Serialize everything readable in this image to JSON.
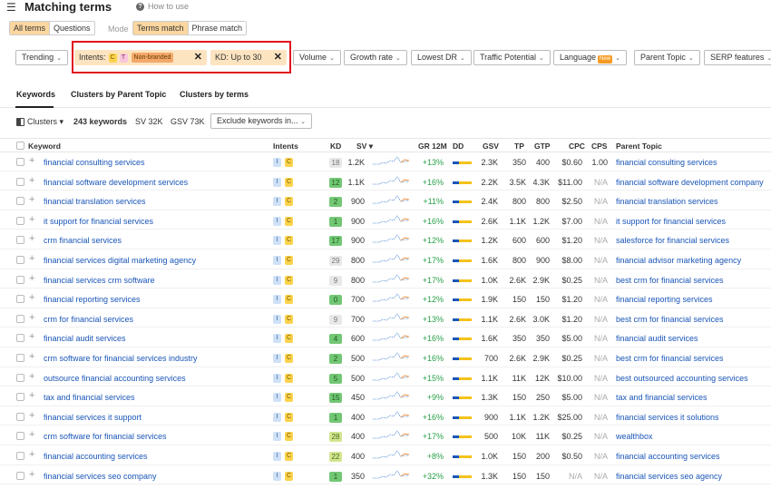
{
  "header": {
    "menu_icon": "hamburger-icon",
    "title": "Matching terms",
    "help_label": "How to use"
  },
  "tabs_primary": [
    {
      "label": "All terms",
      "active": true
    },
    {
      "label": "Questions",
      "active": false
    }
  ],
  "mode": {
    "label": "Mode",
    "options": [
      {
        "label": "Terms match",
        "active": true
      },
      {
        "label": "Phrase match",
        "active": false
      }
    ]
  },
  "filters": {
    "trending": "Trending",
    "intents_label": "Intents:",
    "intent_c": "C",
    "intent_t": "T",
    "non_branded": "Non-branded",
    "kd_label": "KD: Up to 30",
    "close": "✕",
    "volume": "Volume",
    "growth": "Growth rate",
    "lowest_dr": "Lowest DR",
    "traffic_potential": "Traffic Potential",
    "language": "Language",
    "new_badge": "New",
    "parent_topic": "Parent Topic",
    "serp": "SERP features"
  },
  "view_tabs": [
    {
      "label": "Keywords",
      "active": true
    },
    {
      "label": "Clusters by Parent Topic",
      "active": false
    },
    {
      "label": "Clusters by terms",
      "active": false
    }
  ],
  "summary": {
    "clusters": "Clusters",
    "keywords": "243 keywords",
    "sv": "SV 32K",
    "gsv": "GSV 73K",
    "exclude": "Exclude keywords in..."
  },
  "columns": {
    "keyword": "Keyword",
    "intents": "Intents",
    "kd": "KD",
    "sv": "SV",
    "gr": "GR 12M",
    "dd": "DD",
    "gsv": "GSV",
    "tp": "TP",
    "gtp": "GTP",
    "cpc": "CPC",
    "cps": "CPS",
    "parent": "Parent Topic"
  },
  "rows": [
    {
      "kw": "financial consulting services",
      "kd": "18",
      "sv": "1.2K",
      "gr": "+13%",
      "gsv": "2.3K",
      "tp": "350",
      "gtp": "400",
      "cpc": "$0.60",
      "cps": "1.00",
      "parent": "financial consulting services"
    },
    {
      "kw": "financial software development services",
      "kd": "12",
      "sv": "1.1K",
      "gr": "+16%",
      "gsv": "2.2K",
      "tp": "3.5K",
      "gtp": "4.3K",
      "cpc": "$11.00",
      "cps": "N/A",
      "parent": "financial software development company"
    },
    {
      "kw": "financial translation services",
      "kd": "2",
      "sv": "900",
      "gr": "+11%",
      "gsv": "2.4K",
      "tp": "800",
      "gtp": "800",
      "cpc": "$2.50",
      "cps": "N/A",
      "parent": "financial translation services"
    },
    {
      "kw": "it support for financial services",
      "kd": "1",
      "sv": "900",
      "gr": "+16%",
      "gsv": "2.6K",
      "tp": "1.1K",
      "gtp": "1.2K",
      "cpc": "$7.00",
      "cps": "N/A",
      "parent": "it support for financial services"
    },
    {
      "kw": "crm financial services",
      "kd": "17",
      "sv": "900",
      "gr": "+12%",
      "gsv": "1.2K",
      "tp": "600",
      "gtp": "600",
      "cpc": "$1.20",
      "cps": "N/A",
      "parent": "salesforce for financial services"
    },
    {
      "kw": "financial services digital marketing agency",
      "kd": "29",
      "sv": "800",
      "gr": "+17%",
      "gsv": "1.6K",
      "tp": "800",
      "gtp": "900",
      "cpc": "$8.00",
      "cps": "N/A",
      "parent": "financial advisor marketing agency"
    },
    {
      "kw": "financial services crm software",
      "kd": "9",
      "sv": "800",
      "gr": "+17%",
      "gsv": "1.0K",
      "tp": "2.6K",
      "gtp": "2.9K",
      "cpc": "$0.25",
      "cps": "N/A",
      "parent": "best crm for financial services"
    },
    {
      "kw": "financial reporting services",
      "kd": "0",
      "sv": "700",
      "gr": "+12%",
      "gsv": "1.9K",
      "tp": "150",
      "gtp": "150",
      "cpc": "$1.20",
      "cps": "N/A",
      "parent": "financial reporting services"
    },
    {
      "kw": "crm for financial services",
      "kd": "9",
      "sv": "700",
      "gr": "+13%",
      "gsv": "1.1K",
      "tp": "2.6K",
      "gtp": "3.0K",
      "cpc": "$1.20",
      "cps": "N/A",
      "parent": "best crm for financial services"
    },
    {
      "kw": "financial audit services",
      "kd": "4",
      "sv": "600",
      "gr": "+16%",
      "gsv": "1.6K",
      "tp": "350",
      "gtp": "350",
      "cpc": "$5.00",
      "cps": "N/A",
      "parent": "financial audit services"
    },
    {
      "kw": "crm software for financial services industry",
      "kd": "2",
      "sv": "500",
      "gr": "+16%",
      "gsv": "700",
      "tp": "2.6K",
      "gtp": "2.9K",
      "cpc": "$0.25",
      "cps": "N/A",
      "parent": "best crm for financial services"
    },
    {
      "kw": "outsource financial accounting services",
      "kd": "5",
      "sv": "500",
      "gr": "+15%",
      "gsv": "1.1K",
      "tp": "11K",
      "gtp": "12K",
      "cpc": "$10.00",
      "cps": "N/A",
      "parent": "best outsourced accounting services"
    },
    {
      "kw": "tax and financial services",
      "kd": "15",
      "sv": "450",
      "gr": "+9%",
      "gsv": "1.3K",
      "tp": "150",
      "gtp": "250",
      "cpc": "$5.00",
      "cps": "N/A",
      "parent": "tax and financial services"
    },
    {
      "kw": "financial services it support",
      "kd": "1",
      "sv": "400",
      "gr": "+16%",
      "gsv": "900",
      "tp": "1.1K",
      "gtp": "1.2K",
      "cpc": "$25.00",
      "cps": "N/A",
      "parent": "financial services it solutions"
    },
    {
      "kw": "crm software for financial services",
      "kd": "28",
      "sv": "400",
      "gr": "+17%",
      "gsv": "500",
      "tp": "10K",
      "gtp": "11K",
      "cpc": "$0.25",
      "cps": "N/A",
      "parent": "wealthbox"
    },
    {
      "kw": "financial accounting services",
      "kd": "22",
      "sv": "400",
      "gr": "+8%",
      "gsv": "1.0K",
      "tp": "150",
      "gtp": "200",
      "cpc": "$0.50",
      "cps": "N/A",
      "parent": "financial accounting services"
    },
    {
      "kw": "financial services seo company",
      "kd": "1",
      "sv": "350",
      "gr": "+32%",
      "gsv": "1.3K",
      "tp": "150",
      "gtp": "150",
      "cpc": "N/A",
      "cps": "N/A",
      "parent": "financial services seo agency"
    }
  ],
  "colors": {
    "accent_orange": "#fbd69f",
    "link_blue": "#1a56b8",
    "growth_green": "#27a046",
    "highlight_red": "#e0141e"
  }
}
